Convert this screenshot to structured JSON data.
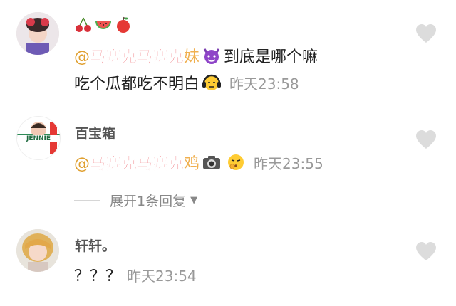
{
  "comments": [
    {
      "mention_prefix": "@",
      "mention_redacted": "马赛克马赛克",
      "mention_suffix": "妹",
      "text_after_emoji": " 到底是哪个嘛",
      "line2": "吃个瓜都吃不明白",
      "time": "昨天23:58"
    },
    {
      "username": "百宝箱",
      "mention_prefix": "@",
      "mention_redacted": "马赛克马赛克",
      "mention_suffix": "鸡",
      "time": "昨天23:55"
    },
    {
      "username": "轩轩。",
      "text": "？？？",
      "time": "昨天23:54"
    }
  ],
  "replies": {
    "label": "展开1条回复"
  },
  "avatar2_text": "JENNIE",
  "colors": {
    "mention": "#e0a030",
    "redact": "#e3141e",
    "time": "#999999",
    "heart": "#dcdcdc"
  }
}
